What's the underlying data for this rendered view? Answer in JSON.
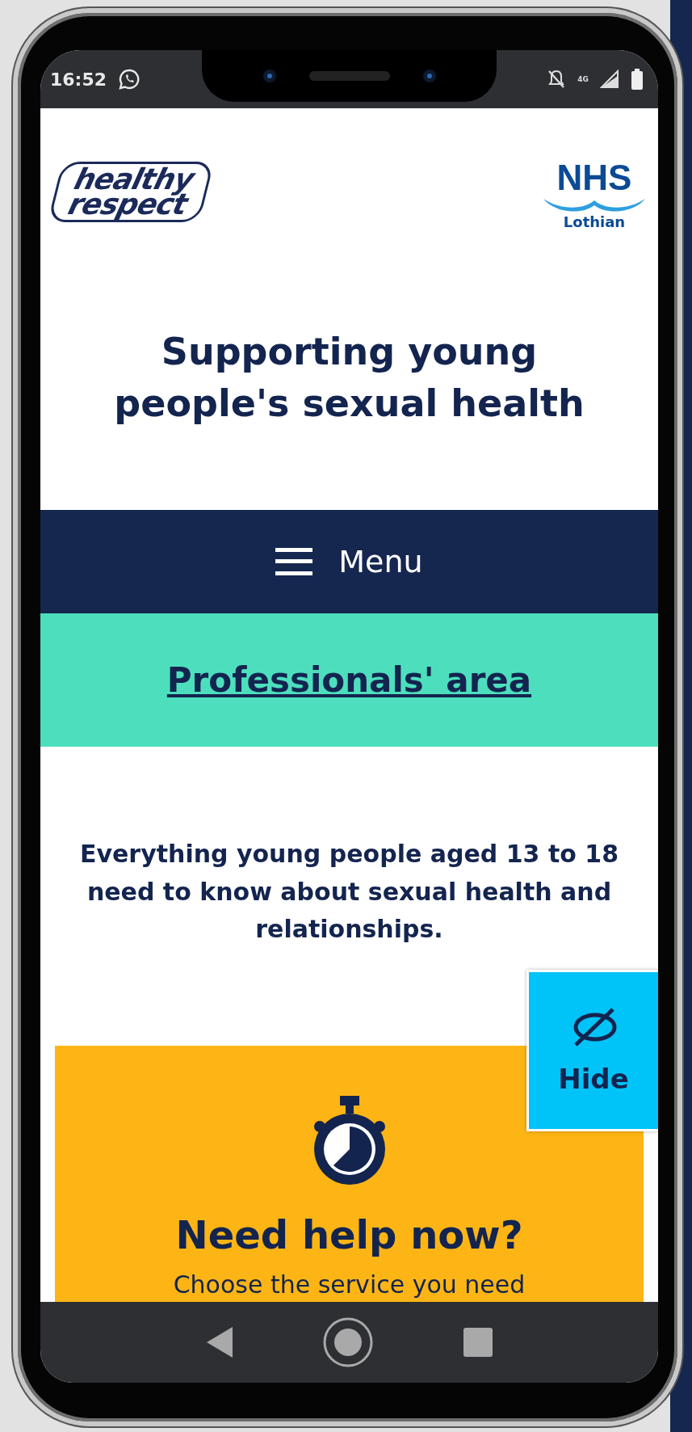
{
  "status_bar": {
    "time": "16:52",
    "network": "4G"
  },
  "header": {
    "logo_top": "healthy",
    "logo_bottom": "respect",
    "nhs": "NHS",
    "nhs_region": "Lothian"
  },
  "title": "Supporting young people's sexual health",
  "menu_button": "Menu",
  "professionals_link": "Professionals' area",
  "intro": "Everything young people aged 13 to 18 need to know about sexual health and relationships.",
  "help_card": {
    "heading": "Need help now?",
    "subtitle": "Choose the service you need"
  },
  "hide_button": "Hide"
}
